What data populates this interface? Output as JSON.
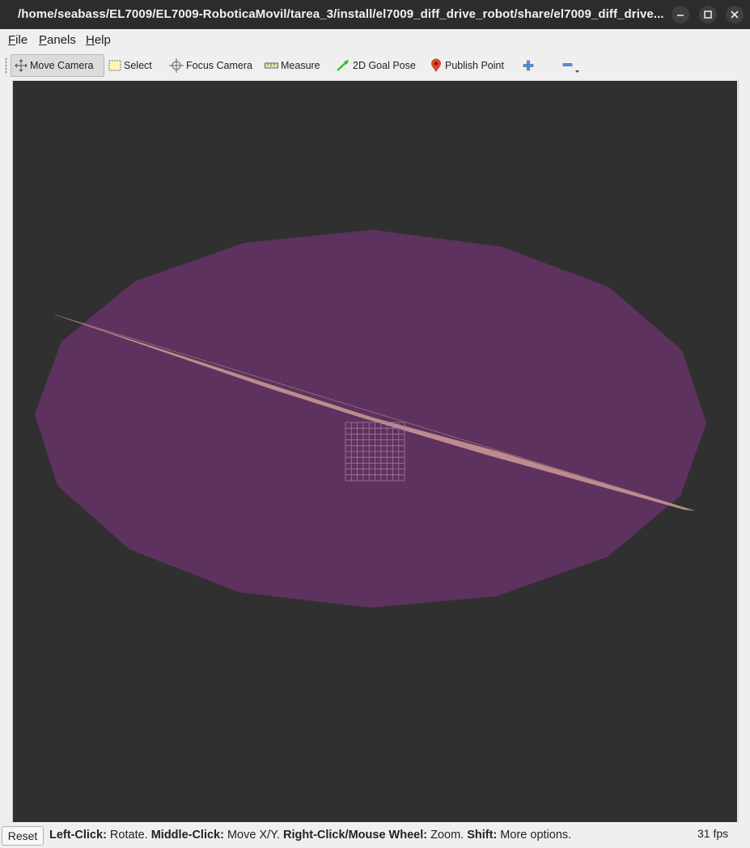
{
  "window": {
    "title": "/home/seabass/EL7009/EL7009-RoboticaMovil/tarea_3/install/el7009_diff_drive_robot/share/el7009_diff_drive..."
  },
  "menu": [
    {
      "label": "File",
      "underline": "F",
      "rest": "ile"
    },
    {
      "label": "Panels",
      "underline": "P",
      "rest": "anels"
    },
    {
      "label": "Help",
      "underline": "H",
      "rest": "elp"
    }
  ],
  "toolbar": {
    "move_camera": "Move Camera",
    "select": "Select",
    "focus_camera": "Focus Camera",
    "measure": "Measure",
    "goal_pose": "2D Goal Pose",
    "publish_point": "Publish Point",
    "add_icon": "plus-icon",
    "remove_icon": "minus-icon"
  },
  "status": {
    "reset": "Reset",
    "hints": [
      {
        "key": "Left-Click:",
        "desc": " Rotate. "
      },
      {
        "key": "Middle-Click:",
        "desc": " Move X/Y. "
      },
      {
        "key": "Right-Click/Mouse Wheel:",
        "desc": " Zoom. "
      },
      {
        "key": "Shift:",
        "desc": " More options."
      }
    ],
    "fps": "31 fps"
  },
  "colors": {
    "viewport_bg": "#303030",
    "disc": "#5e325e",
    "beam": "#c59292",
    "grid": "#a87aa8",
    "titlebar": "#2c2c2c"
  }
}
